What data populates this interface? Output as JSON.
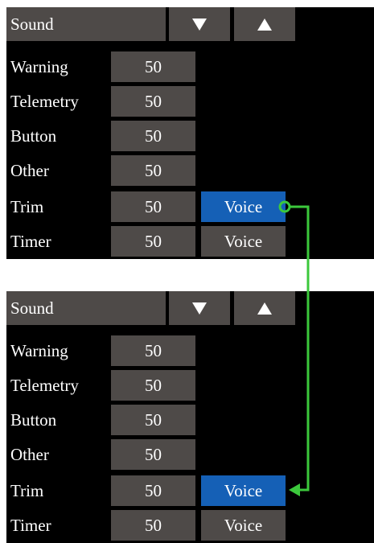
{
  "screens": [
    {
      "title": "Sound",
      "down_icon": "triangle-down-icon",
      "up_icon": "triangle-up-icon",
      "rows": [
        {
          "label": "Warning",
          "value": "50"
        },
        {
          "label": "Telemetry",
          "value": "50"
        },
        {
          "label": "Button",
          "value": "50"
        },
        {
          "label": "Other",
          "value": "50"
        },
        {
          "label": "Trim",
          "value": "50",
          "voice": "Voice"
        },
        {
          "label": "Timer",
          "value": "50",
          "voice": "Voice"
        }
      ]
    },
    {
      "title": "Sound",
      "down_icon": "triangle-down-icon",
      "up_icon": "triangle-up-icon",
      "rows": [
        {
          "label": "Warning",
          "value": "50"
        },
        {
          "label": "Telemetry",
          "value": "50"
        },
        {
          "label": "Button",
          "value": "50"
        },
        {
          "label": "Other",
          "value": "50"
        },
        {
          "label": "Trim",
          "value": "50",
          "voice": "Voice"
        },
        {
          "label": "Timer",
          "value": "50",
          "voice": "Voice"
        }
      ]
    }
  ],
  "colors": {
    "background": "#000000",
    "cell": "#4e4a48",
    "active": "#1560b6",
    "arrow": "#3cc83c"
  }
}
